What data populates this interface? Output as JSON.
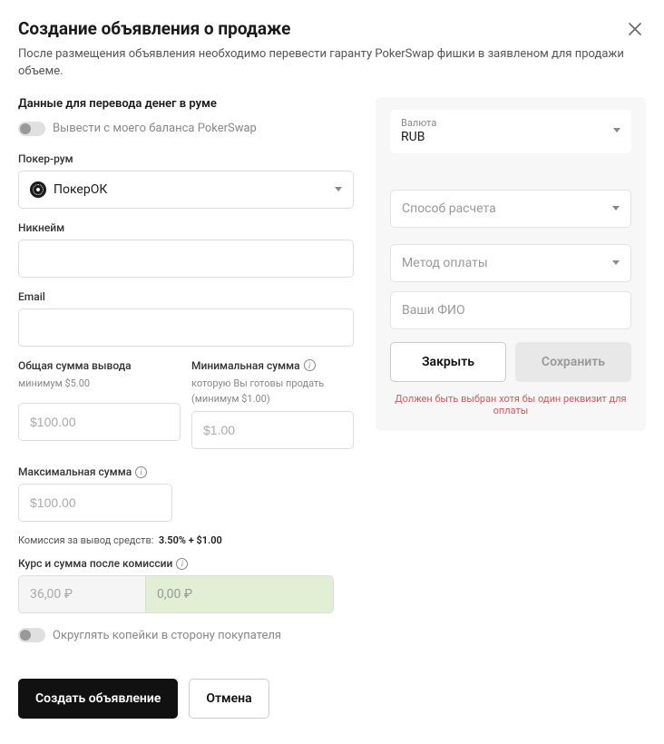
{
  "header": {
    "title": "Создание объявления о продаже",
    "subtitle": "После размещения объявления необходимо перевести гаранту PokerSwap фишки в заявленом для продажи объеме."
  },
  "left": {
    "section_heading": "Данные для перевода денег в руме",
    "toggle_withdraw_label": "Вывести с моего баланса PokerSwap",
    "poker_room_label": "Покер-рум",
    "poker_room_value": "ПокерОК",
    "nickname_label": "Никнейм",
    "email_label": "Email",
    "total_sum_label": "Общая сумма вывода",
    "total_sum_sub": "минимум $5.00",
    "total_sum_placeholder": "$100.00",
    "min_sum_label": "Минимальная сумма",
    "min_sum_sub1": "которую Вы готовы продать",
    "min_sum_sub2": "(минимум $1.00)",
    "min_sum_placeholder": "$1.00",
    "max_sum_label": "Максимальная сумма",
    "max_sum_placeholder": "$100.00",
    "commission_label": "Комиссия за вывод средств:",
    "commission_value": "3.50% + $1.00",
    "rate_label": "Курс и сумма после комиссии",
    "rate_placeholder": "36,00 ₽",
    "rate_result_placeholder": "0,00 ₽",
    "round_toggle_label": "Округлять копейки в сторону покупателя",
    "create_btn": "Создать объявление",
    "cancel_btn": "Отмена"
  },
  "right": {
    "currency_label": "Валюта",
    "currency_value": "RUB",
    "calc_method_placeholder": "Способ расчета",
    "payment_method_placeholder": "Метод оплаты",
    "fio_placeholder": "Ваши ФИО",
    "close_btn": "Закрыть",
    "save_btn": "Сохранить",
    "error": "Должен быть выбран хотя бы один реквизит для оплаты"
  }
}
